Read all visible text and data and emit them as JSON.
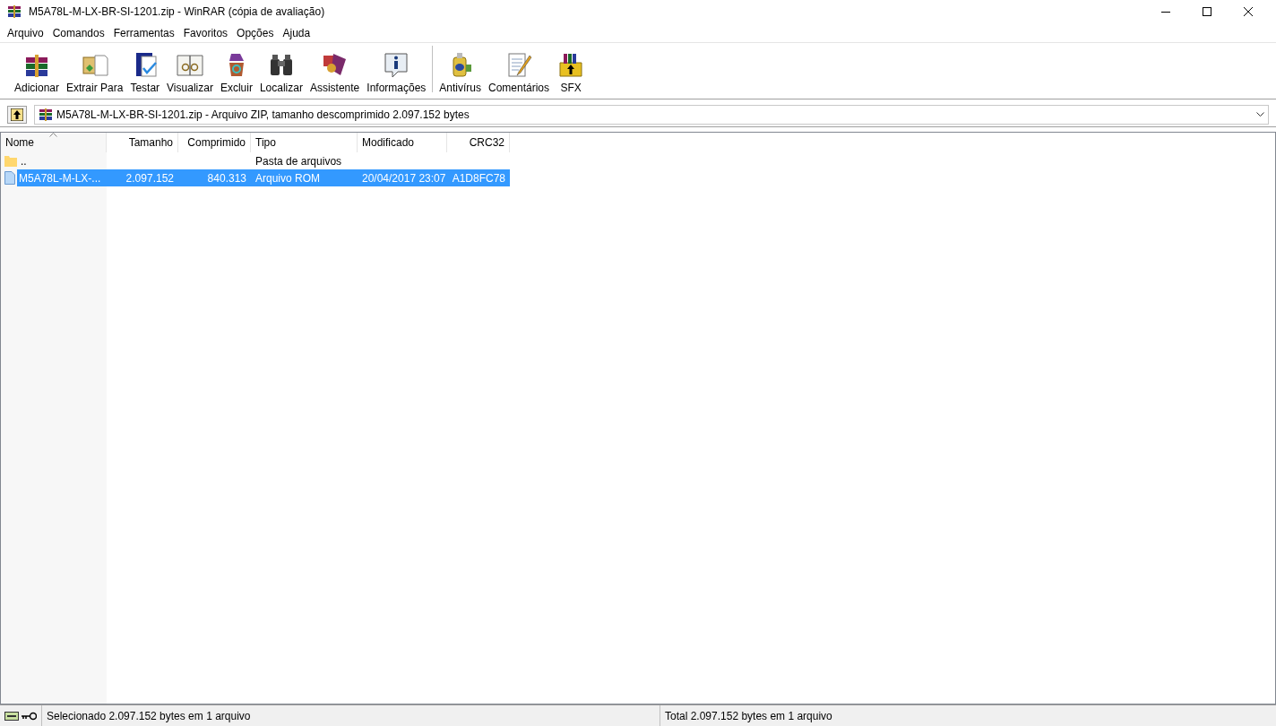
{
  "window": {
    "title": "M5A78L-M-LX-BR-SI-1201.zip - WinRAR (cópia de avaliação)"
  },
  "menu": [
    "Arquivo",
    "Comandos",
    "Ferramentas",
    "Favoritos",
    "Opções",
    "Ajuda"
  ],
  "toolbar": [
    {
      "label": "Adicionar"
    },
    {
      "label": "Extrair Para"
    },
    {
      "label": "Testar"
    },
    {
      "label": "Visualizar"
    },
    {
      "label": "Excluir"
    },
    {
      "label": "Localizar"
    },
    {
      "label": "Assistente"
    },
    {
      "label": "Informações"
    },
    {
      "label": "Antivírus"
    },
    {
      "label": "Comentários"
    },
    {
      "label": "SFX"
    }
  ],
  "address": {
    "value": "M5A78L-M-LX-BR-SI-1201.zip - Arquivo ZIP, tamanho descomprimido 2.097.152 bytes"
  },
  "table": {
    "columns": [
      "Nome",
      "Tamanho",
      "Comprimido",
      "Tipo",
      "Modificado",
      "CRC32"
    ],
    "rows": [
      {
        "kind": "folder",
        "selected": false,
        "cells": [
          "..",
          "",
          "",
          "Pasta de arquivos",
          "",
          ""
        ]
      },
      {
        "kind": "file",
        "selected": true,
        "cells": [
          "M5A78L-M-LX-...",
          "2.097.152",
          "840.313",
          "Arquivo ROM",
          "20/04/2017 23:07",
          "A1D8FC78"
        ]
      }
    ]
  },
  "status_bar": {
    "left": "Selecionado 2.097.152 bytes em 1 arquivo",
    "right": "Total 2.097.152 bytes em 1 arquivo"
  }
}
